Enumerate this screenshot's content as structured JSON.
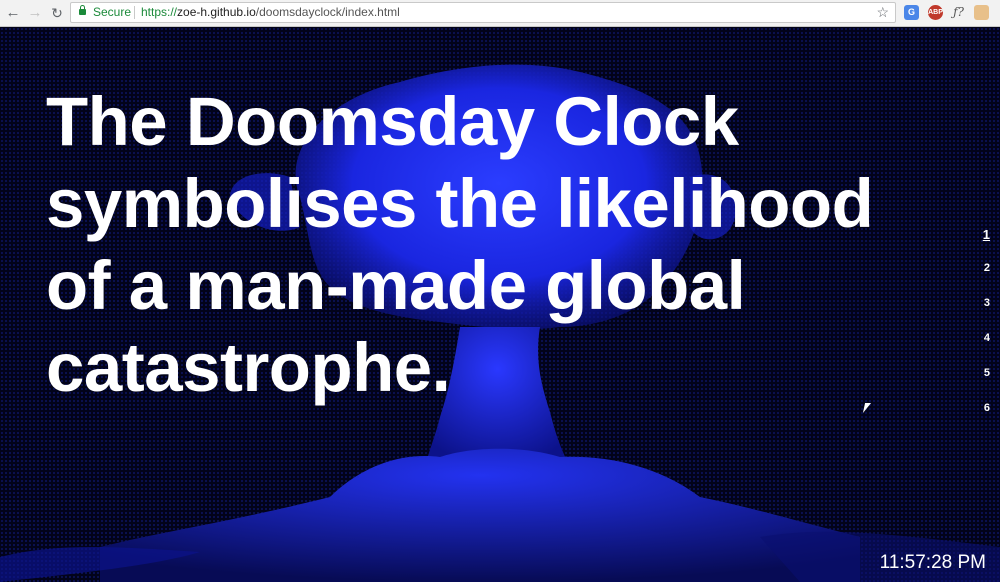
{
  "browser": {
    "secure_label": "Secure",
    "url_scheme": "https://",
    "url_host": "zoe-h.github.io",
    "url_path": "/doomsdayclock/index.html",
    "extensions": {
      "abp_label": "ABP",
      "fx_label": "ƒ?"
    }
  },
  "main": {
    "headline": "The Doomsday Clock symbolises the likelihood of a man-made global catastrophe.",
    "slides": [
      "1",
      "2",
      "3",
      "4",
      "5",
      "6"
    ],
    "active_slide": "1",
    "time": "11:57:28 PM"
  },
  "colors": {
    "accent_blue": "#1a2cff",
    "background": "#02031a",
    "secure_green": "#1b8a3a"
  },
  "icons": [
    "back-arrow-icon",
    "forward-arrow-icon",
    "reload-icon",
    "lock-icon",
    "star-icon",
    "mushroom-cloud-image",
    "cursor-icon"
  ]
}
